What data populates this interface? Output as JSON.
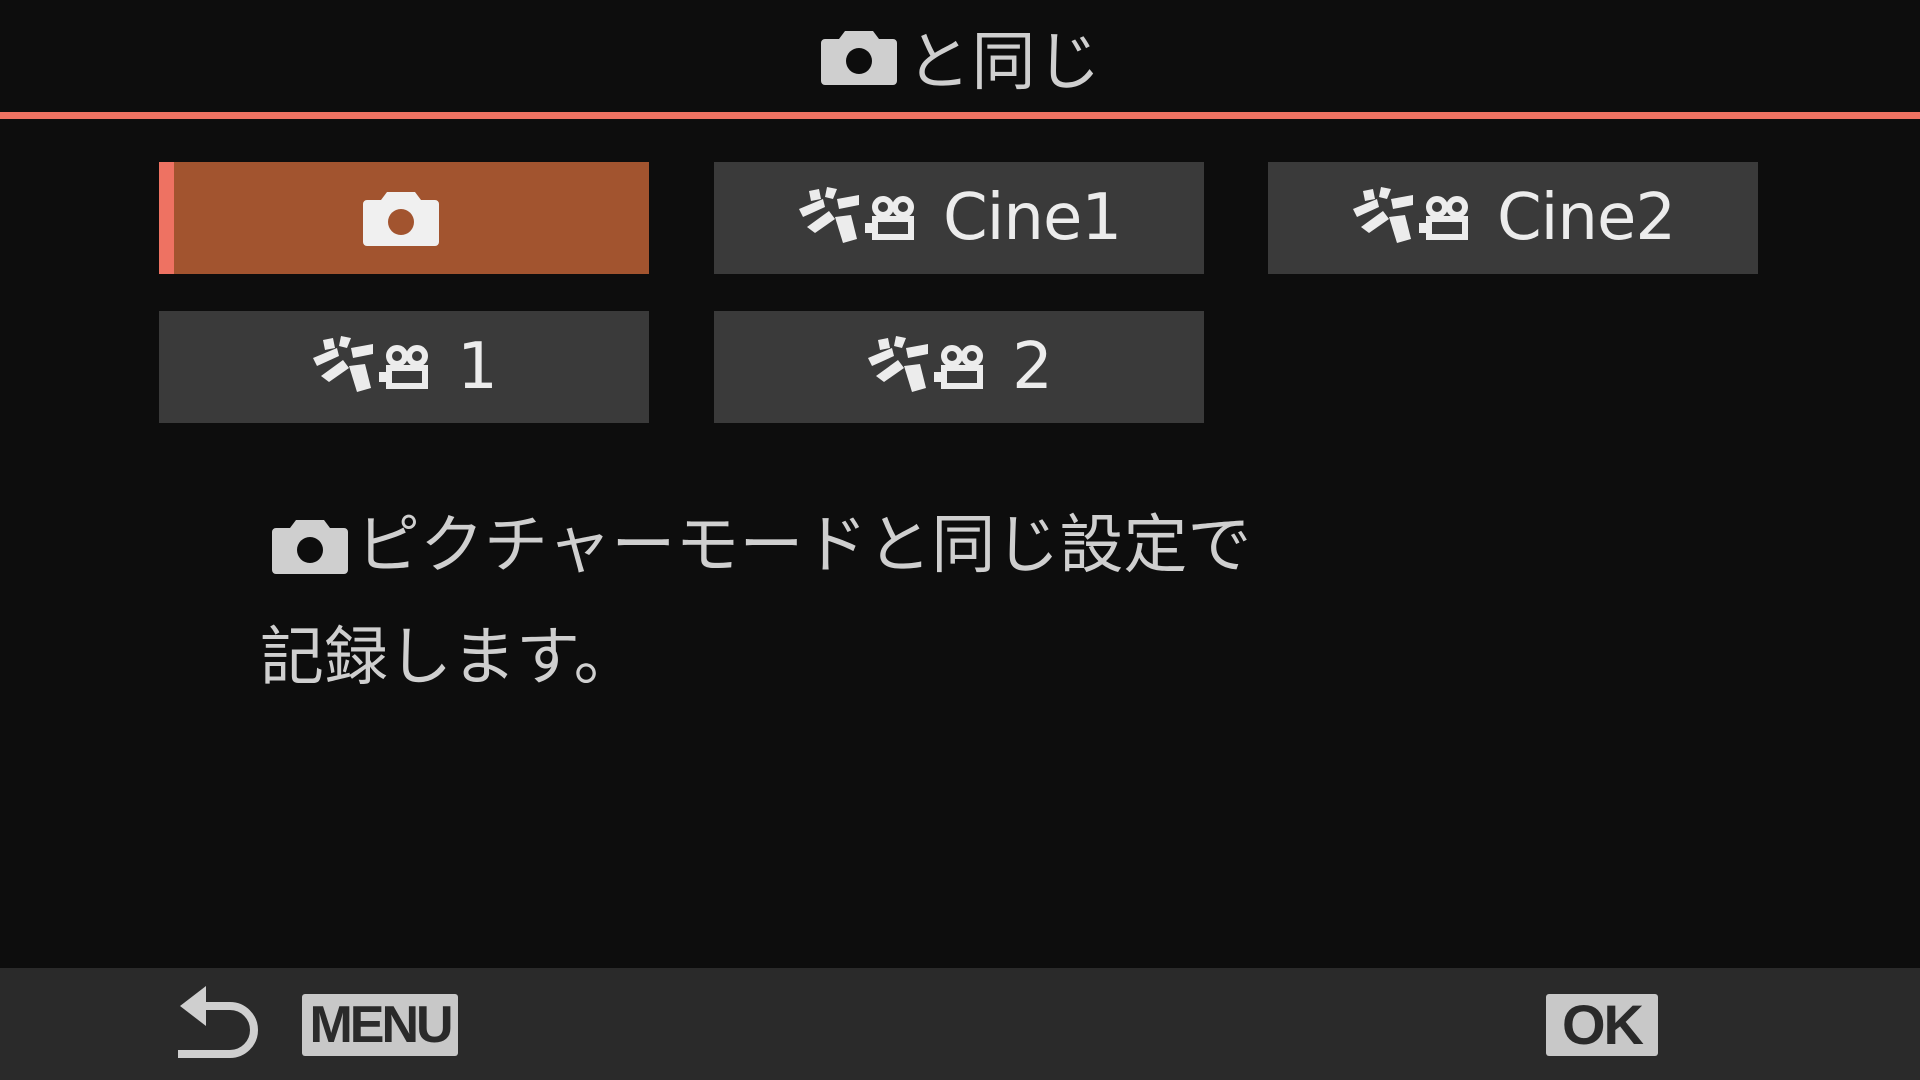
{
  "header": {
    "icon": "camera-icon",
    "title": "と同じ"
  },
  "options": [
    {
      "icon": "camera-icon",
      "label": "",
      "selected": true
    },
    {
      "icon": "movie-log-icon",
      "label": "Cine1",
      "selected": false
    },
    {
      "icon": "movie-log-icon",
      "label": "Cine2",
      "selected": false
    },
    {
      "icon": "movie-log-icon",
      "label": "1",
      "selected": false
    },
    {
      "icon": "movie-log-icon",
      "label": "2",
      "selected": false
    }
  ],
  "description": {
    "line1_icon": "camera-icon",
    "line1": "ピクチャーモードと同じ設定で",
    "line2": "記録します。"
  },
  "footer": {
    "back_icon": "back-arrow-icon",
    "menu_label": "MENU",
    "ok_label": "OK"
  },
  "colors": {
    "accent": "#ee7262",
    "selected_bg": "#a2542f",
    "option_bg": "#3a3a3a",
    "footer_bg": "#2a2a2a",
    "background": "#0d0d0d"
  }
}
